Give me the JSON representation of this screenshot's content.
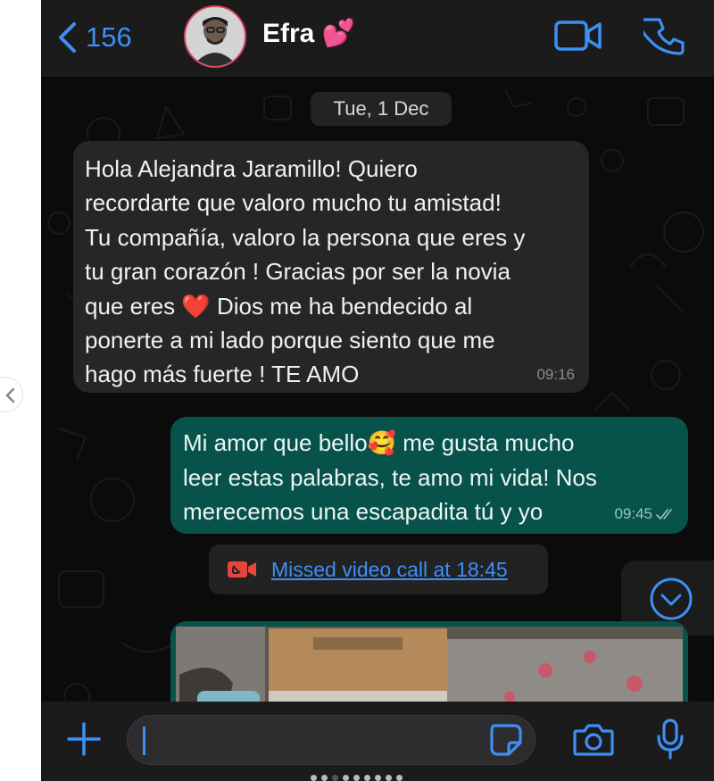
{
  "header": {
    "back_count": "156",
    "contact_name": "Efra 💕"
  },
  "chat": {
    "date_separator": "Tue, 1 Dec",
    "incoming": {
      "text": "Hola Alejandra Jaramillo! Quiero\nrecordarte que valoro mucho tu amistad!\nTu compañía, valoro la persona que eres y\ntu gran corazón ! Gracias por ser la novia\nque eres ❤️ Dios me ha bendecido al\nponerte a mi lado porque siento que me\nhago más fuerte ! TE AMO",
      "time": "09:16"
    },
    "outgoing": {
      "text": "Mi amor que bello🥰 me gusta mucho\nleer estas palabras, te amo mi vida! Nos\nmerecemos una escapadita tú y yo",
      "time": "09:45"
    },
    "missed_call": {
      "text": "Missed video call at 18:45",
      "icon": "missed-video-call-icon",
      "color": "#e8453c"
    }
  },
  "composer": {
    "placeholder": ""
  },
  "colors": {
    "accent": "#3d8ff5",
    "outgoing_bubble": "#07524a",
    "incoming_bubble": "#262628",
    "background": "#0b0b0b"
  }
}
